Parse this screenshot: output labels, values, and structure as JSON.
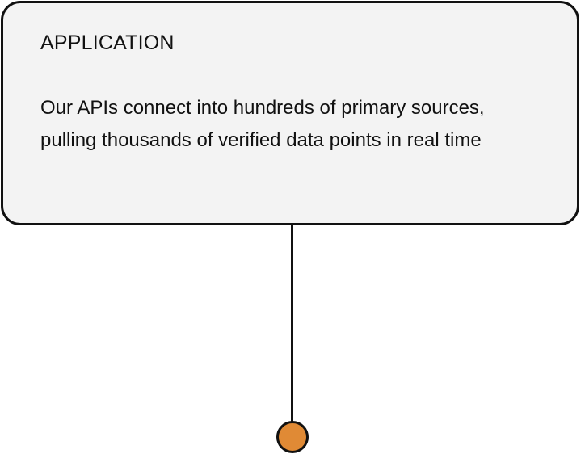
{
  "card": {
    "title": "APPLICATION",
    "body": "Our APIs connect into hundreds of primary sources, pulling thousands of verified data points in real time"
  },
  "colors": {
    "card_background": "#f3f3f3",
    "border": "#111111",
    "node_fill": "#e08a35"
  }
}
